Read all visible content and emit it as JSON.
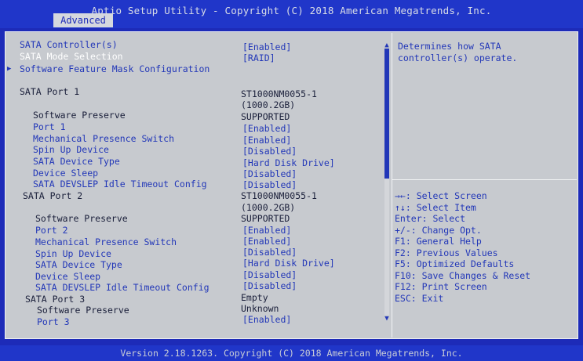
{
  "header": {
    "title": "Aptio Setup Utility - Copyright (C) 2018 American Megatrends, Inc.",
    "active_tab": "Advanced"
  },
  "settings": [
    {
      "label": "SATA Controller(s)",
      "value": "[Enabled]"
    },
    {
      "label": "SATA Mode Selection",
      "value": "[RAID]"
    },
    {
      "label": "Software Feature Mask Configuration",
      "value": ""
    },
    {
      "label": "SATA Port 1",
      "value": "ST1000NM0055-1"
    },
    {
      "label": "",
      "value": "(1000.2GB)"
    },
    {
      "label": "Software Preserve",
      "value": "SUPPORTED"
    },
    {
      "label": "Port 1",
      "value": "[Enabled]"
    },
    {
      "label": "Mechanical Presence Switch",
      "value": "[Enabled]"
    },
    {
      "label": "Spin Up Device",
      "value": "[Disabled]"
    },
    {
      "label": "SATA Device Type",
      "value": "[Hard Disk Drive]"
    },
    {
      "label": "Device Sleep",
      "value": "[Disabled]"
    },
    {
      "label": "SATA DEVSLEP Idle Timeout Config",
      "value": "[Disabled]"
    },
    {
      "label": "SATA Port 2",
      "value": "ST1000NM0055-1"
    },
    {
      "label": "",
      "value": "(1000.2GB)"
    },
    {
      "label": "Software Preserve",
      "value": "SUPPORTED"
    },
    {
      "label": "Port 2",
      "value": "[Enabled]"
    },
    {
      "label": "Mechanical Presence Switch",
      "value": "[Enabled]"
    },
    {
      "label": "Spin Up Device",
      "value": "[Disabled]"
    },
    {
      "label": "SATA Device Type",
      "value": "[Hard Disk Drive]"
    },
    {
      "label": "Device Sleep",
      "value": "[Disabled]"
    },
    {
      "label": "SATA DEVSLEP Idle Timeout Config",
      "value": "[Disabled]"
    },
    {
      "label": "SATA Port 3",
      "value": "Empty"
    },
    {
      "label": "Software Preserve",
      "value": "Unknown"
    },
    {
      "label": "Port 3",
      "value": "[Enabled]"
    }
  ],
  "help": {
    "lines": [
      "Determines how SATA",
      "controller(s) operate."
    ]
  },
  "keys": [
    "→←: Select Screen",
    "↑↓: Select Item",
    "Enter: Select",
    "+/-: Change Opt.",
    "F1: General Help",
    "F2: Previous Values",
    "F5: Optimized Defaults",
    "F10: Save Changes & Reset",
    "F12: Print Screen",
    "ESC: Exit"
  ],
  "footer": {
    "text": "Version 2.18.1263. Copyright (C) 2018 American Megatrends, Inc."
  },
  "colors": {
    "background": "#1d2bb8",
    "panel": "#c7cacf",
    "accent_text": "#2237b8",
    "static_text": "#1a1f3a",
    "selected_text": "#ffffff"
  }
}
